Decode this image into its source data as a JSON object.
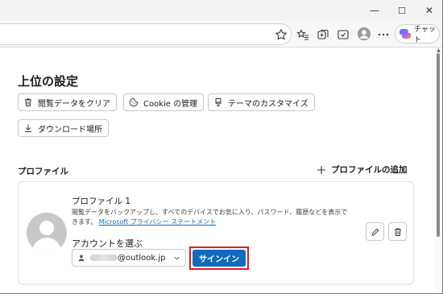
{
  "window": {
    "minimize_glyph": "—",
    "maximize_glyph": "☐",
    "close_glyph": "✕"
  },
  "toolbar": {
    "chat_label": "チャット",
    "icons": [
      "star-icon",
      "favorites-icon",
      "collections-icon",
      "screenshot-icon",
      "profile-icon",
      "more-icon",
      "copilot-icon"
    ]
  },
  "settings": {
    "section_title": "上位の設定",
    "chips": [
      {
        "label": "閲覧データをクリア",
        "icon": "trash-icon"
      },
      {
        "label": "Cookie の管理",
        "icon": "cookie-icon"
      },
      {
        "label": "テーマのカスタマイズ",
        "icon": "brush-icon"
      },
      {
        "label": "ダウンロード場所",
        "icon": "download-icon"
      }
    ]
  },
  "profiles": {
    "heading": "プロファイル",
    "add_label": "プロファイルの追加",
    "card": {
      "name": "プロファイル 1",
      "description_line1": "閲覧データをバックアップし、すべてのデバイスでお気に入り、パスワード、履歴などを表示で",
      "description_line2_prefix": "きます。",
      "privacy_link": "Microsoft プライバシー ステートメント",
      "choose_label": "アカウントを選ぶ",
      "account_suffix": "@outlook.jp",
      "signin_label": "サインイン"
    }
  },
  "colors": {
    "accent": "#0f6cbd",
    "highlight": "#e01b24"
  }
}
